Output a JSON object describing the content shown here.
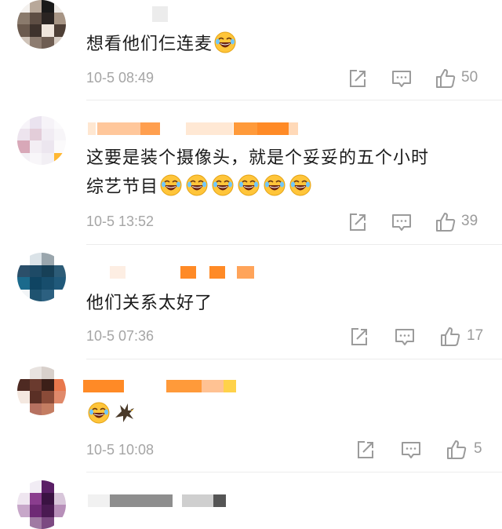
{
  "comments": [
    {
      "name": "",
      "text_lines": [
        "想看他们仨连麦"
      ],
      "emojis": [
        "laugh-cry-emoji"
      ],
      "time": "10-5 08:49",
      "likes": "50"
    },
    {
      "name": "",
      "text_lines": [
        "这要是装个摄像头，就是个妥妥的五个小时",
        "综艺节目"
      ],
      "emojis": [
        "laugh-cry-emoji",
        "laugh-cry-emoji",
        "laugh-cry-emoji",
        "laugh-cry-emoji",
        "laugh-cry-emoji",
        "laugh-cry-emoji"
      ],
      "time": "10-5 13:52",
      "likes": "39"
    },
    {
      "name": "",
      "text_lines": [
        "他们关系太好了"
      ],
      "emojis": [],
      "time": "10-5 07:36",
      "likes": "17"
    },
    {
      "name": "",
      "text_lines": [
        ""
      ],
      "emojis": [
        "laugh-cry-emoji",
        "eagle-emoji"
      ],
      "time": "10-5 10:08",
      "likes": "5"
    }
  ],
  "icons": {
    "share": "share-icon",
    "comment": "comment-icon",
    "like": "thumbs-up-icon"
  },
  "colors": {
    "meta_text": "#a5a5a5",
    "icon_gray": "#9b9b9b",
    "emoji_face": "#ffc53a"
  }
}
